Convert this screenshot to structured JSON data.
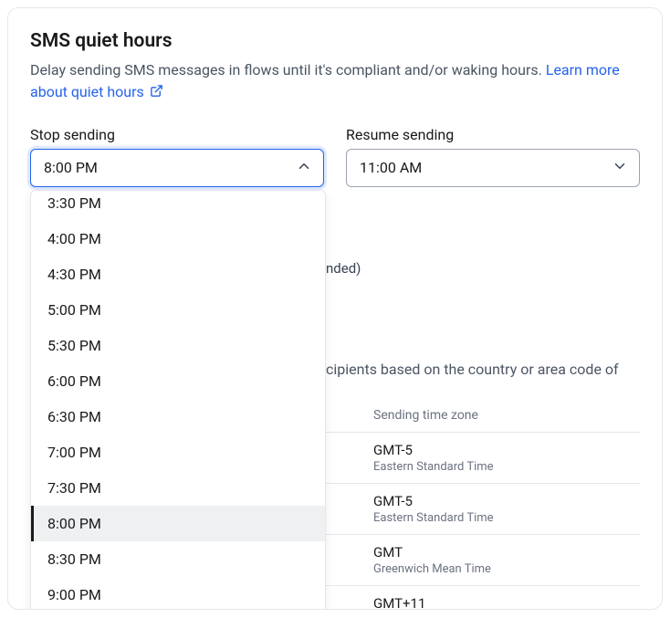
{
  "title": "SMS quiet hours",
  "description": "Delay sending SMS messages in flows until it's compliant and/or waking hours. ",
  "learnMoreText": "Learn more about quiet hours",
  "stopSending": {
    "label": "Stop sending",
    "value": "8:00 PM",
    "options": [
      "3:30 PM",
      "4:00 PM",
      "4:30 PM",
      "5:00 PM",
      "5:30 PM",
      "6:00 PM",
      "6:30 PM",
      "7:00 PM",
      "7:30 PM",
      "8:00 PM",
      "8:30 PM",
      "9:00 PM"
    ]
  },
  "resumeSending": {
    "label": "Resume sending",
    "value": "11:00 AM"
  },
  "recommendedSuffix": "nded)",
  "timezoneDescFragment": "cipients based on the country or area code of",
  "timezoneTable": {
    "header": "Sending time zone",
    "rows": [
      {
        "code": "GMT-5",
        "name": "Eastern Standard Time"
      },
      {
        "code": "GMT-5",
        "name": "Eastern Standard Time"
      },
      {
        "code": "GMT",
        "name": "Greenwich Mean Time"
      },
      {
        "code": "GMT+11",
        "name": ""
      }
    ]
  }
}
